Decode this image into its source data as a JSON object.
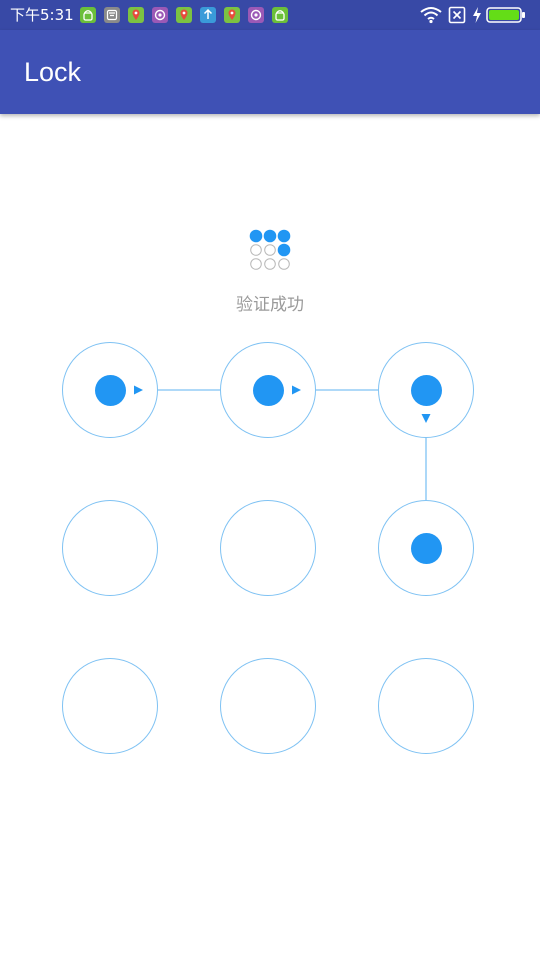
{
  "status_bar": {
    "time": "下午5:31",
    "notification_icons": [
      "android-icon",
      "tooth-icon",
      "maps-icon",
      "camera-icon",
      "maps-icon",
      "upload-icon",
      "maps-icon",
      "camera-icon",
      "android-icon"
    ],
    "notification_icon_colors": [
      "#6bbf3a",
      "#8a8a8a",
      "#7cc242",
      "#9b59b6",
      "#7cc242",
      "#3a9ad9",
      "#7cc242",
      "#9b59b6",
      "#6bbf3a"
    ],
    "system_icons": [
      "wifi-icon",
      "no-sim-icon",
      "charging-icon",
      "battery-icon"
    ],
    "background_color": "#3849a6"
  },
  "app_bar": {
    "title": "Lock",
    "background_color": "#3f51b5"
  },
  "mini_indicator": {
    "selected": [
      true,
      true,
      true,
      false,
      false,
      true,
      false,
      false,
      false
    ]
  },
  "status_message": "验证成功",
  "pattern": {
    "selected_sequence": [
      1,
      2,
      3,
      6
    ],
    "selected": [
      true,
      true,
      true,
      false,
      false,
      true,
      false,
      false,
      false
    ],
    "accent_color": "#2196f3",
    "ring_color": "#7fc2f3"
  }
}
